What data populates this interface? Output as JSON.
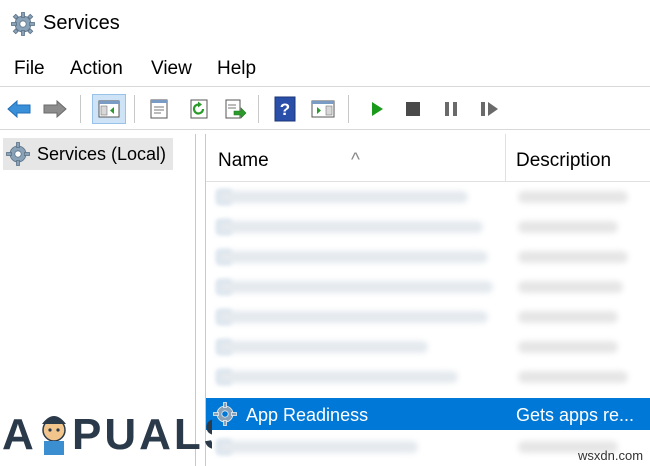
{
  "window": {
    "title": "Services"
  },
  "menu": {
    "file": "File",
    "action": "Action",
    "view": "View",
    "help": "Help"
  },
  "toolbar": {
    "buttons": [
      "back-icon",
      "forward-icon",
      "show-hide-tree-icon",
      "properties-icon",
      "refresh-icon",
      "export-list-icon",
      "help-icon",
      "action-pane-icon",
      "start-service-icon",
      "stop-service-icon",
      "pause-service-icon",
      "resume-service-icon"
    ]
  },
  "tree": {
    "root_label": "Services (Local)"
  },
  "table": {
    "columns": {
      "name": "Name",
      "description": "Description"
    },
    "selected_row": {
      "name": "App Readiness",
      "description": "Gets apps re..."
    }
  },
  "watermark": {
    "brand": "APPUALS",
    "site": "wsxdn.com"
  },
  "colors": {
    "selection": "#0078d7",
    "play": "#1a9a1a",
    "help_icon": "#2a4fa8"
  }
}
